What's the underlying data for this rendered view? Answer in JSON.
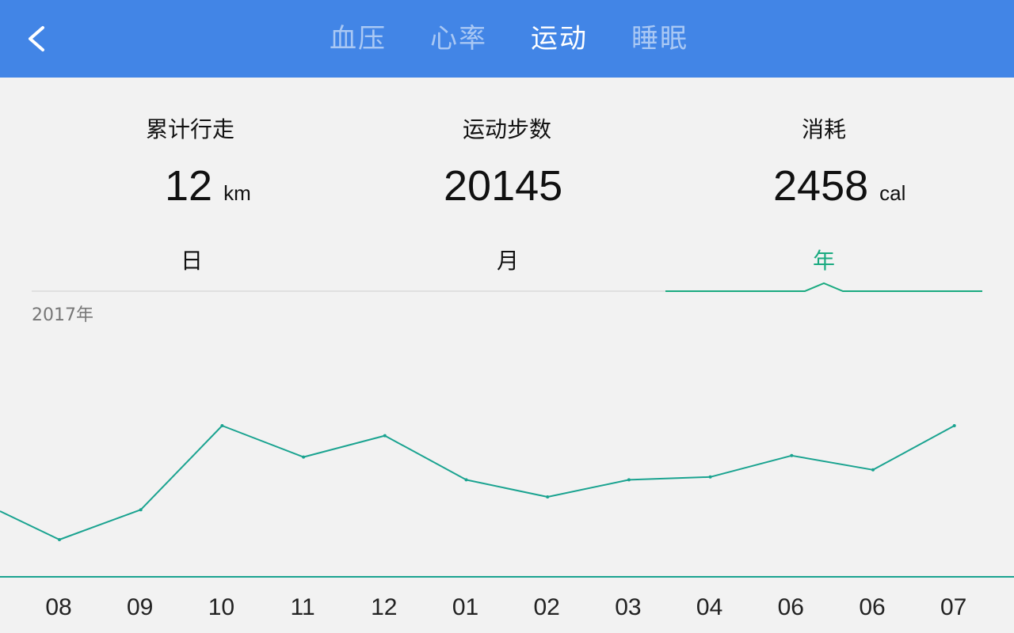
{
  "nav": {
    "tabs": [
      {
        "label": "血压"
      },
      {
        "label": "心率"
      },
      {
        "label": "运动"
      },
      {
        "label": "睡眠"
      }
    ]
  },
  "stats": {
    "distance": {
      "label": "累计行走",
      "value": "12",
      "unit": "km"
    },
    "steps": {
      "label": "运动步数",
      "value": "20145"
    },
    "calories": {
      "label": "消耗",
      "value": "2458",
      "unit": "cal"
    }
  },
  "period_tabs": [
    {
      "label": "日"
    },
    {
      "label": "月"
    },
    {
      "label": "年"
    }
  ],
  "year_label": "2017年",
  "colors": {
    "header": "#4285e6",
    "accent": "#1aaa80",
    "line": "#1aa390"
  },
  "chart_data": {
    "type": "line",
    "categories": [
      "08",
      "09",
      "10",
      "11",
      "12",
      "01",
      "02",
      "03",
      "04",
      "06",
      "06",
      "07"
    ],
    "values": [
      10,
      31,
      90,
      68,
      83,
      52,
      40,
      52,
      54,
      69,
      59,
      90
    ],
    "ylim": [
      0,
      100
    ],
    "grid": false
  }
}
